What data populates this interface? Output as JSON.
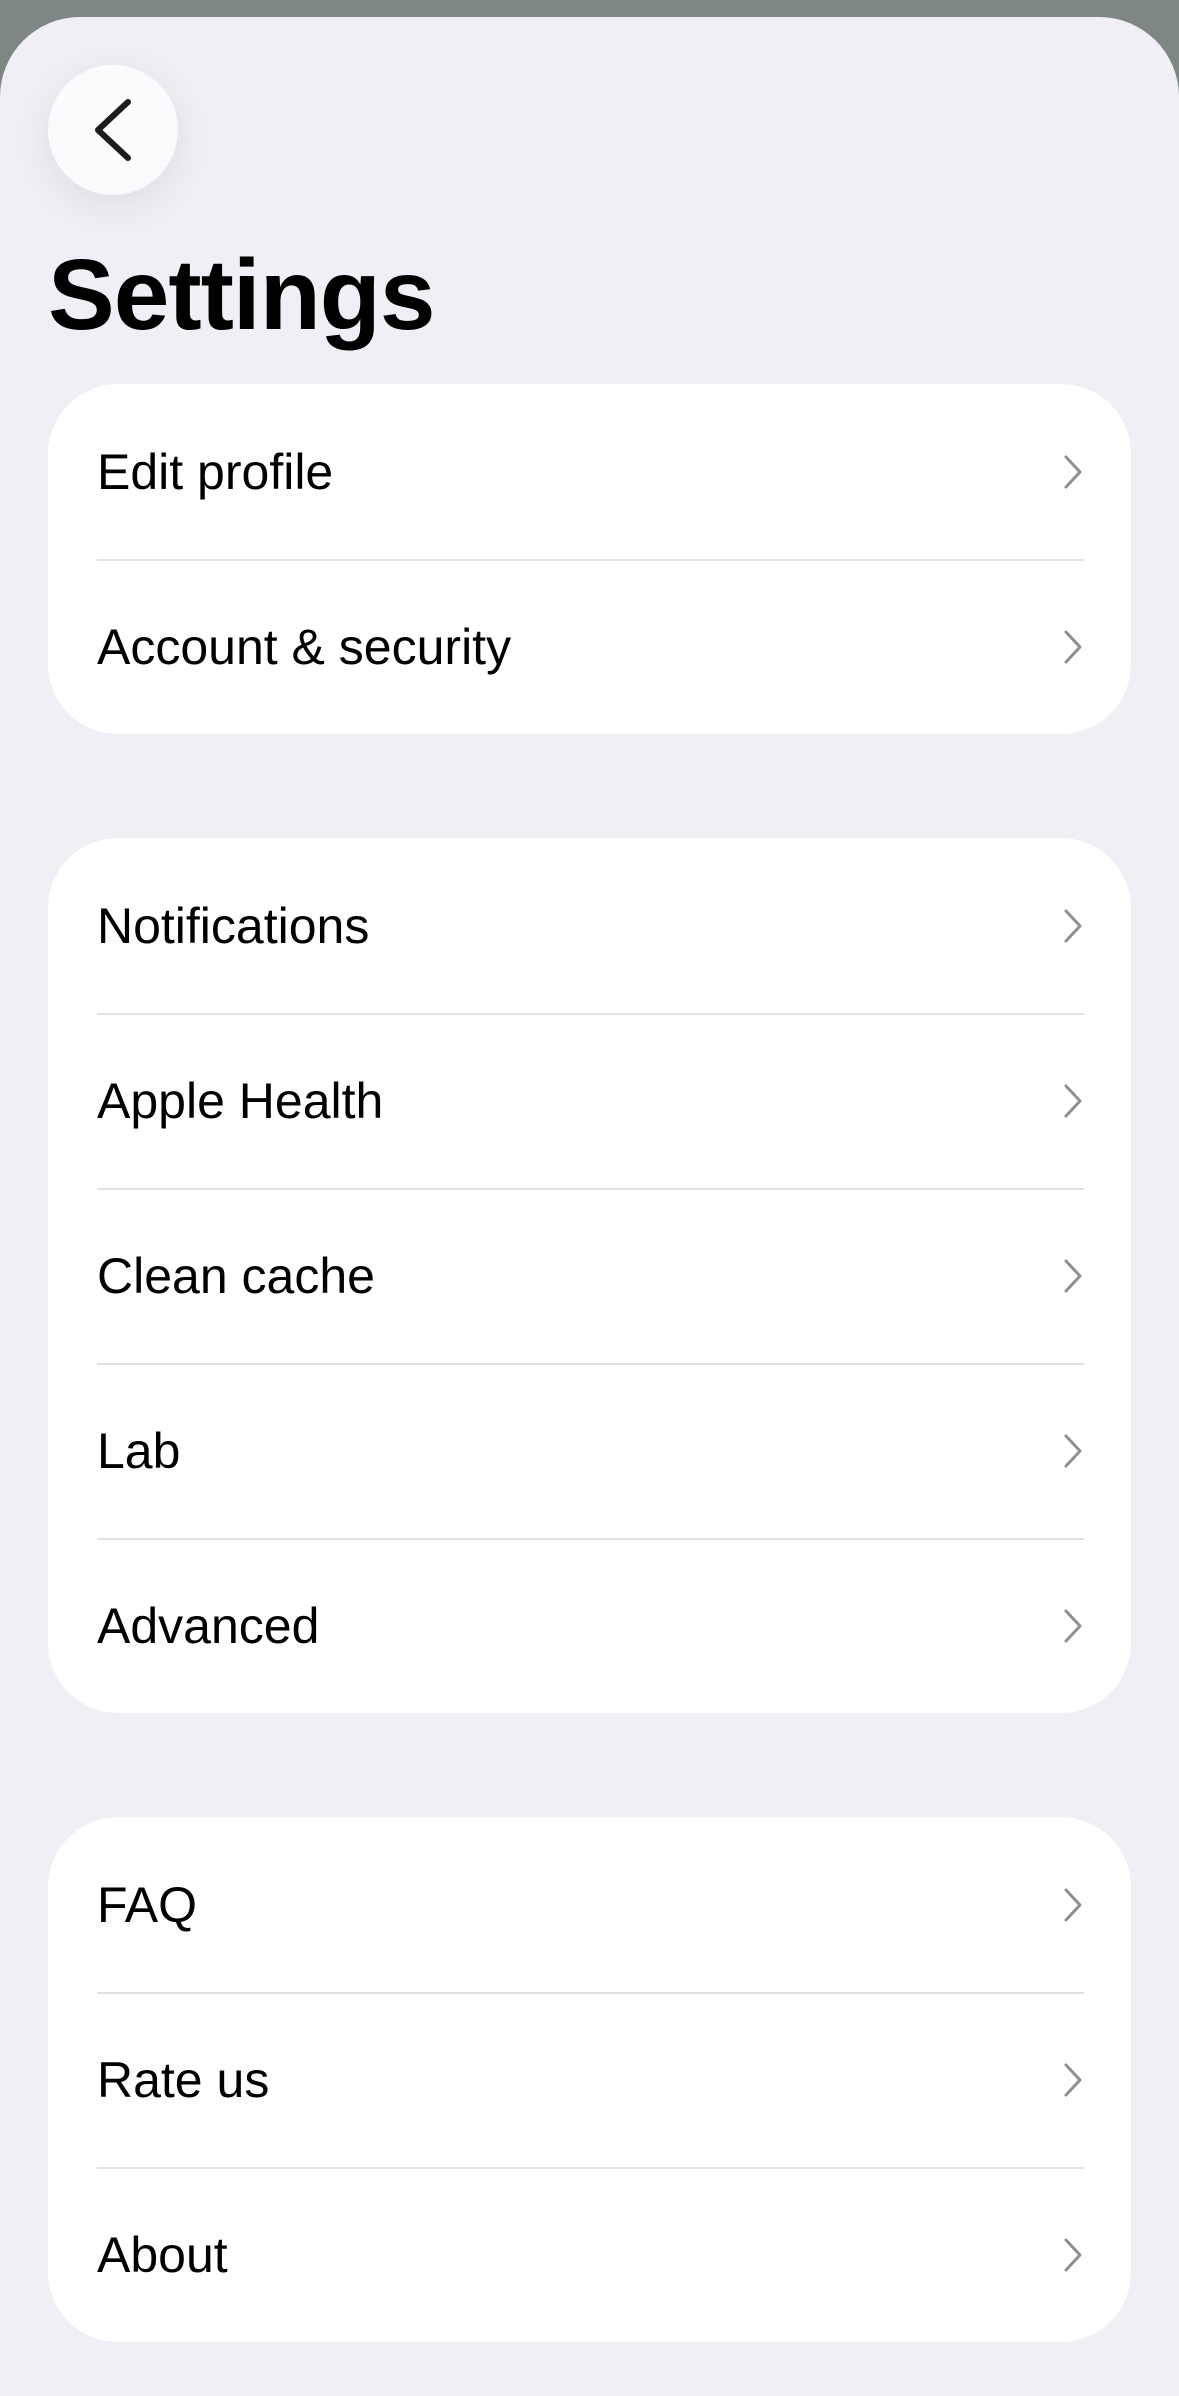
{
  "header": {
    "title": "Settings",
    "back_icon": "chevron-left-icon"
  },
  "groups": [
    {
      "items": [
        {
          "label": "Edit profile"
        },
        {
          "label": "Account & security"
        }
      ]
    },
    {
      "items": [
        {
          "label": "Notifications"
        },
        {
          "label": "Apple Health"
        },
        {
          "label": "Clean cache"
        },
        {
          "label": "Lab"
        },
        {
          "label": "Advanced"
        }
      ]
    },
    {
      "items": [
        {
          "label": "FAQ"
        },
        {
          "label": "Rate us"
        },
        {
          "label": "About"
        }
      ]
    }
  ],
  "colors": {
    "background": "#f0eff5",
    "card": "#ffffff",
    "separator": "#e2e2e6",
    "chevron": "#8e8e93",
    "dimmed_backdrop": "#7e8784"
  }
}
